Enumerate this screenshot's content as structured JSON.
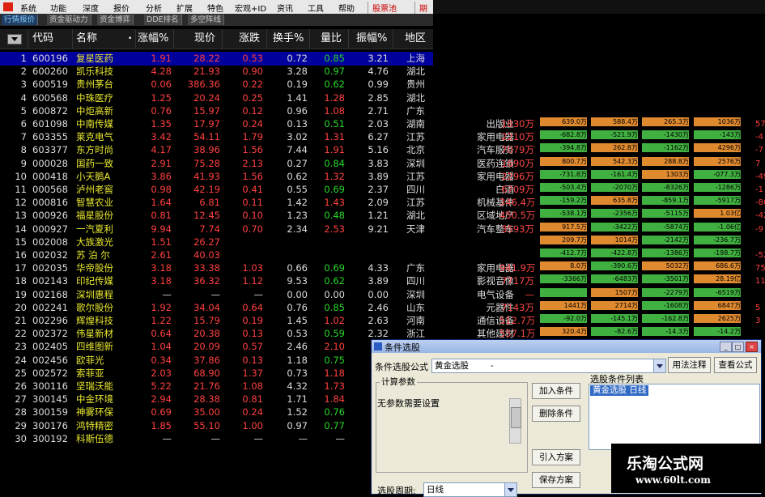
{
  "menubar": {
    "items": [
      "系统",
      "功能",
      "深度",
      "报价",
      "分析",
      "扩展",
      "特色",
      "宏观+ID",
      "资讯",
      "工具",
      "帮助"
    ],
    "stock_pool": "股票池",
    "tail": "期"
  },
  "tabs": [
    "行情报价",
    "资金驱动力",
    "资金博弈",
    "DDE排名",
    "多空阵线"
  ],
  "table": {
    "headers": [
      "代码",
      "名称",
      "涨幅%",
      "现价",
      "涨跌",
      "换手%",
      "量比",
      "振幅%",
      "地区"
    ],
    "sort_mark": "•",
    "rows": [
      {
        "no": "1",
        "code": "600196",
        "name": "复星医药",
        "pct": "1.91",
        "price": "28.22",
        "chg": "0.53",
        "turn": "0.72",
        "vol": "0.85",
        "amp": "3.21",
        "region": "上海",
        "d": "up",
        "vd": "dn"
      },
      {
        "no": "2",
        "code": "600260",
        "name": "凯乐科技",
        "pct": "4.28",
        "price": "21.93",
        "chg": "0.90",
        "turn": "3.28",
        "vol": "0.97",
        "amp": "4.76",
        "region": "湖北",
        "d": "up",
        "vd": "dn"
      },
      {
        "no": "3",
        "code": "600519",
        "name": "贵州茅台",
        "pct": "0.06",
        "price": "386.36",
        "chg": "0.22",
        "turn": "0.19",
        "vol": "0.62",
        "amp": "0.99",
        "region": "贵州",
        "d": "up",
        "vd": "dn"
      },
      {
        "no": "4",
        "code": "600568",
        "name": "中珠医疗",
        "pct": "1.25",
        "price": "20.24",
        "chg": "0.25",
        "turn": "1.41",
        "vol": "1.28",
        "amp": "2.85",
        "region": "湖北",
        "d": "up",
        "vd": "up"
      },
      {
        "no": "5",
        "code": "600872",
        "name": "中炬高新",
        "pct": "0.76",
        "price": "15.97",
        "chg": "0.12",
        "turn": "0.96",
        "vol": "1.08",
        "amp": "2.71",
        "region": "广东",
        "d": "up",
        "vd": "up"
      },
      {
        "no": "6",
        "code": "601098",
        "name": "中南传媒",
        "pct": "1.35",
        "price": "17.97",
        "chg": "0.24",
        "turn": "0.13",
        "vol": "0.51",
        "amp": "2.03",
        "region": "湖南",
        "d": "up",
        "vd": "dn"
      },
      {
        "no": "7",
        "code": "603355",
        "name": "莱克电气",
        "pct": "3.42",
        "price": "54.11",
        "chg": "1.79",
        "turn": "3.02",
        "vol": "1.31",
        "amp": "6.27",
        "region": "江苏",
        "d": "up",
        "vd": "up"
      },
      {
        "no": "8",
        "code": "603377",
        "name": "东方时尚",
        "pct": "4.17",
        "price": "38.96",
        "chg": "1.56",
        "turn": "7.44",
        "vol": "1.91",
        "amp": "5.16",
        "region": "北京",
        "d": "up",
        "vd": "up"
      },
      {
        "no": "9",
        "code": "000028",
        "name": "国药一致",
        "pct": "2.91",
        "price": "75.28",
        "chg": "2.13",
        "turn": "0.27",
        "vol": "0.84",
        "amp": "3.83",
        "region": "深圳",
        "d": "up",
        "vd": "dn"
      },
      {
        "no": "10",
        "code": "000418",
        "name": "小天鹅A",
        "pct": "3.86",
        "price": "41.93",
        "chg": "1.56",
        "turn": "0.62",
        "vol": "1.32",
        "amp": "3.89",
        "region": "江苏",
        "d": "up",
        "vd": "up"
      },
      {
        "no": "11",
        "code": "000568",
        "name": "泸州老窖",
        "pct": "0.98",
        "price": "42.19",
        "chg": "0.41",
        "turn": "0.55",
        "vol": "0.69",
        "amp": "2.37",
        "region": "四川",
        "d": "up",
        "vd": "dn"
      },
      {
        "no": "12",
        "code": "000816",
        "name": "智慧农业",
        "pct": "1.64",
        "price": "6.81",
        "chg": "0.11",
        "turn": "1.42",
        "vol": "1.43",
        "amp": "2.09",
        "region": "江苏",
        "d": "up",
        "vd": "up"
      },
      {
        "no": "13",
        "code": "000926",
        "name": "福星股份",
        "pct": "0.81",
        "price": "12.45",
        "chg": "0.10",
        "turn": "1.23",
        "vol": "0.48",
        "amp": "1.21",
        "region": "湖北",
        "d": "up",
        "vd": "dn"
      },
      {
        "no": "14",
        "code": "000927",
        "name": "一汽夏利",
        "pct": "9.94",
        "price": "7.74",
        "chg": "0.70",
        "turn": "2.34",
        "vol": "2.53",
        "amp": "9.21",
        "region": "天津",
        "d": "up",
        "vd": "up"
      },
      {
        "no": "15",
        "code": "002008",
        "name": "大族激光",
        "pct": "1.51",
        "price": "26.27",
        "chg": "",
        "turn": "",
        "vol": "",
        "amp": "",
        "region": "",
        "d": "up",
        "vd": "eq"
      },
      {
        "no": "16",
        "code": "002032",
        "name": "苏 泊 尔",
        "pct": "2.61",
        "price": "40.03",
        "chg": "",
        "turn": "",
        "vol": "",
        "amp": "",
        "region": "",
        "d": "up",
        "vd": "eq"
      },
      {
        "no": "17",
        "code": "002035",
        "name": "华帝股份",
        "pct": "3.18",
        "price": "33.38",
        "chg": "1.03",
        "turn": "0.66",
        "vol": "0.69",
        "amp": "4.33",
        "region": "广东",
        "d": "up",
        "vd": "dn"
      },
      {
        "no": "18",
        "code": "002143",
        "name": "印纪传媒",
        "pct": "3.18",
        "price": "36.32",
        "chg": "1.12",
        "turn": "9.53",
        "vol": "0.62",
        "amp": "3.89",
        "region": "四川",
        "d": "up",
        "vd": "dn"
      },
      {
        "no": "19",
        "code": "002168",
        "name": "深圳惠程",
        "pct": "—",
        "price": "—",
        "chg": "—",
        "turn": "0.00",
        "vol": "0.00",
        "amp": "0.00",
        "region": "深圳",
        "d": "eq",
        "vd": "eq"
      },
      {
        "no": "20",
        "code": "002241",
        "name": "歌尔股份",
        "pct": "1.92",
        "price": "34.04",
        "chg": "0.64",
        "turn": "0.76",
        "vol": "0.85",
        "amp": "2.46",
        "region": "山东",
        "d": "up",
        "vd": "dn"
      },
      {
        "no": "21",
        "code": "002296",
        "name": "辉煌科技",
        "pct": "1.22",
        "price": "15.79",
        "chg": "0.19",
        "turn": "1.45",
        "vol": "1.02",
        "amp": "2.63",
        "region": "河南",
        "d": "up",
        "vd": "up"
      },
      {
        "no": "22",
        "code": "002372",
        "name": "伟星新材",
        "pct": "0.64",
        "price": "20.38",
        "chg": "0.13",
        "turn": "0.53",
        "vol": "0.59",
        "amp": "2.32",
        "region": "浙江",
        "d": "up",
        "vd": "dn"
      },
      {
        "no": "23",
        "code": "002405",
        "name": "四维图新",
        "pct": "1.04",
        "price": "20.09",
        "chg": "0.57",
        "turn": "2.46",
        "vol": "2.10",
        "amp": "",
        "region": "",
        "d": "up",
        "vd": "up"
      },
      {
        "no": "24",
        "code": "002456",
        "name": "欧菲光",
        "pct": "0.34",
        "price": "37.86",
        "chg": "0.13",
        "turn": "1.18",
        "vol": "0.75",
        "amp": "",
        "region": "",
        "d": "up",
        "vd": "dn"
      },
      {
        "no": "25",
        "code": "002572",
        "name": "索菲亚",
        "pct": "2.03",
        "price": "68.90",
        "chg": "1.37",
        "turn": "0.73",
        "vol": "1.18",
        "amp": "",
        "region": "",
        "d": "up",
        "vd": "up"
      },
      {
        "no": "26",
        "code": "300116",
        "name": "坚瑞沃能",
        "pct": "5.22",
        "price": "21.76",
        "chg": "1.08",
        "turn": "4.32",
        "vol": "1.73",
        "amp": "",
        "region": "",
        "d": "up",
        "vd": "up"
      },
      {
        "no": "27",
        "code": "300145",
        "name": "中金环境",
        "pct": "2.94",
        "price": "28.38",
        "chg": "0.81",
        "turn": "1.71",
        "vol": "1.84",
        "amp": "",
        "region": "",
        "d": "up",
        "vd": "up"
      },
      {
        "no": "28",
        "code": "300159",
        "name": "神雾环保",
        "pct": "0.69",
        "price": "35.00",
        "chg": "0.24",
        "turn": "1.52",
        "vol": "0.76",
        "amp": "",
        "region": "",
        "d": "up",
        "vd": "dn"
      },
      {
        "no": "29",
        "code": "300176",
        "name": "鸿特精密",
        "pct": "1.85",
        "price": "55.10",
        "chg": "1.00",
        "turn": "0.97",
        "vol": "0.77",
        "amp": "",
        "region": "",
        "d": "up",
        "vd": "dn"
      },
      {
        "no": "30",
        "code": "300192",
        "name": "科斯伍德",
        "pct": "—",
        "price": "—",
        "chg": "—",
        "turn": "—",
        "vol": "—",
        "amp": "",
        "region": "",
        "d": "eq",
        "vd": "eq"
      }
    ]
  },
  "sectors": {
    "rows": [
      {
        "name": "",
        "amt": "",
        "bars": []
      },
      {
        "name": "",
        "amt": "",
        "bars": []
      },
      {
        "name": "",
        "amt": "",
        "bars": []
      },
      {
        "name": "",
        "amt": "",
        "bars": []
      },
      {
        "name": "",
        "amt": "",
        "bars": []
      },
      {
        "name": "出版业",
        "amt": "1830万",
        "bars": [
          {
            "v": "639.0万",
            "c": "o"
          },
          {
            "v": "588.4万",
            "c": "o"
          },
          {
            "v": "265.3万",
            "c": "o"
          },
          {
            "v": "1036万",
            "c": "o"
          }
        ],
        "edge": "57"
      },
      {
        "name": "家用电器",
        "amt": "2210万",
        "bars": [
          {
            "v": "-682.8万",
            "c": "g"
          },
          {
            "v": "-521.9万",
            "c": "g"
          },
          {
            "v": "-1430万",
            "c": "g"
          },
          {
            "v": "-143万",
            "c": "g"
          }
        ],
        "edge": "-4"
      },
      {
        "name": "汽车服务",
        "amt": "7079万",
        "bars": [
          {
            "v": "-394.8万",
            "c": "g"
          },
          {
            "v": "262.8万",
            "c": "o"
          },
          {
            "v": "-1162万",
            "c": "g"
          },
          {
            "v": "4296万",
            "c": "o"
          }
        ],
        "edge": "-7"
      },
      {
        "name": "医药连锁",
        "amt": "1690万",
        "bars": [
          {
            "v": "800.7万",
            "c": "o"
          },
          {
            "v": "542.3万",
            "c": "o"
          },
          {
            "v": "288.8万",
            "c": "o"
          },
          {
            "v": "2576万",
            "c": "o"
          }
        ],
        "edge": "7"
      },
      {
        "name": "家用电器",
        "amt": "2296万",
        "bars": [
          {
            "v": "-731.8万",
            "c": "g"
          },
          {
            "v": "-161.4万",
            "c": "g"
          },
          {
            "v": "1303万",
            "c": "o"
          },
          {
            "v": "-077.3万",
            "c": "g"
          }
        ],
        "edge": "-49"
      },
      {
        "name": "白酒",
        "amt": "6709万",
        "bars": [
          {
            "v": "-503.4万",
            "c": "g"
          },
          {
            "v": "-2070万",
            "c": "g"
          },
          {
            "v": "-8326万",
            "c": "g"
          },
          {
            "v": "-1286万",
            "c": "g"
          }
        ],
        "edge": "-1"
      },
      {
        "name": "机械基件",
        "amt": "346.4万",
        "bars": [
          {
            "v": "-159.2万",
            "c": "g"
          },
          {
            "v": "635.8万",
            "c": "o"
          },
          {
            "v": "-859.1万",
            "c": "g"
          },
          {
            "v": "-5917万",
            "c": "g"
          }
        ],
        "edge": "-80"
      },
      {
        "name": "区域地产",
        "amt": "450.5万",
        "bars": [
          {
            "v": "-538.1万",
            "c": "g"
          },
          {
            "v": "-2356万",
            "c": "g"
          },
          {
            "v": "-5115万",
            "c": "g"
          },
          {
            "v": "1.03亿",
            "c": "o"
          }
        ],
        "edge": "-42"
      },
      {
        "name": "汽车整车",
        "amt": "3593万",
        "bars": [
          {
            "v": "917.5万",
            "c": "o"
          },
          {
            "v": "-3422万",
            "c": "g"
          },
          {
            "v": "-5874万",
            "c": "g"
          },
          {
            "v": "-1.06亿",
            "c": "g"
          }
        ],
        "edge": "-9"
      },
      {
        "name": "",
        "amt": "",
        "bars": [
          {
            "v": "209.7万",
            "c": "o"
          },
          {
            "v": "1014万",
            "c": "o"
          },
          {
            "v": "-2142万",
            "c": "g"
          },
          {
            "v": "-236.7万",
            "c": "g"
          }
        ],
        "edge": ""
      },
      {
        "name": "",
        "amt": "",
        "bars": [
          {
            "v": "-412.7万",
            "c": "g"
          },
          {
            "v": "-422.8万",
            "c": "g"
          },
          {
            "v": "-1386万",
            "c": "g"
          },
          {
            "v": "-198.7万",
            "c": "g"
          }
        ],
        "edge": "-52"
      },
      {
        "name": "家用电器",
        "amt": "941.9万",
        "bars": [
          {
            "v": "8.0万",
            "c": "o"
          },
          {
            "v": "-390.6万",
            "c": "g"
          },
          {
            "v": "5032万",
            "c": "o"
          },
          {
            "v": "686.6万",
            "c": "o"
          }
        ],
        "edge": "75"
      },
      {
        "name": "影视音像",
        "amt": "7717万",
        "bars": [
          {
            "v": "-3366万",
            "c": "g"
          },
          {
            "v": "-6483万",
            "c": "g"
          },
          {
            "v": "-3501万",
            "c": "g"
          },
          {
            "v": "28.19亿",
            "c": "o"
          }
        ],
        "edge": "11"
      },
      {
        "name": "电气设备",
        "amt": "—",
        "bars": [
          {
            "v": "",
            "c": "g"
          },
          {
            "v": "1507万",
            "c": "o"
          },
          {
            "v": "-2279万",
            "c": "g"
          },
          {
            "v": "-6519万",
            "c": "g"
          }
        ],
        "edge": ""
      },
      {
        "name": "元器件",
        "amt": "7143万",
        "bars": [
          {
            "v": "1441万",
            "c": "o"
          },
          {
            "v": "2714万",
            "c": "o"
          },
          {
            "v": "-1608万",
            "c": "g"
          },
          {
            "v": "6847万",
            "c": "o"
          }
        ],
        "edge": "5"
      },
      {
        "name": "通信设备",
        "amt": "512.7万",
        "bars": [
          {
            "v": "-92.0万",
            "c": "g"
          },
          {
            "v": "-145.1万",
            "c": "g"
          },
          {
            "v": "-162.8万",
            "c": "g"
          },
          {
            "v": "2625万",
            "c": "o"
          }
        ],
        "edge": "3"
      },
      {
        "name": "其他建材",
        "amt": "557.1万",
        "bars": [
          {
            "v": "320.4万",
            "c": "o"
          },
          {
            "v": "-82.6万",
            "c": "g"
          },
          {
            "v": "-14.3万",
            "c": "g"
          },
          {
            "v": "-14.2万",
            "c": "g"
          }
        ],
        "edge": ""
      }
    ]
  },
  "dialog": {
    "title": "条件选股",
    "formula_label": "条件选股公式",
    "formula_value": "黄金选股",
    "formula_value_suffix": "-",
    "btn_usage": "用法注释",
    "btn_view": "查看公式",
    "params_group": "计算参数",
    "no_params_text": "无参数需要设置",
    "btn_add": "加入条件",
    "btn_delete": "删除条件",
    "btn_import": "引入方案",
    "btn_save": "保存方案",
    "list_title": "选股条件列表",
    "list_item": "黄金选股   日线",
    "period_label": "选股周期:",
    "period_value": "日线"
  },
  "watermark": {
    "line1": "乐淘公式网",
    "line2": "www.60lt.com"
  }
}
